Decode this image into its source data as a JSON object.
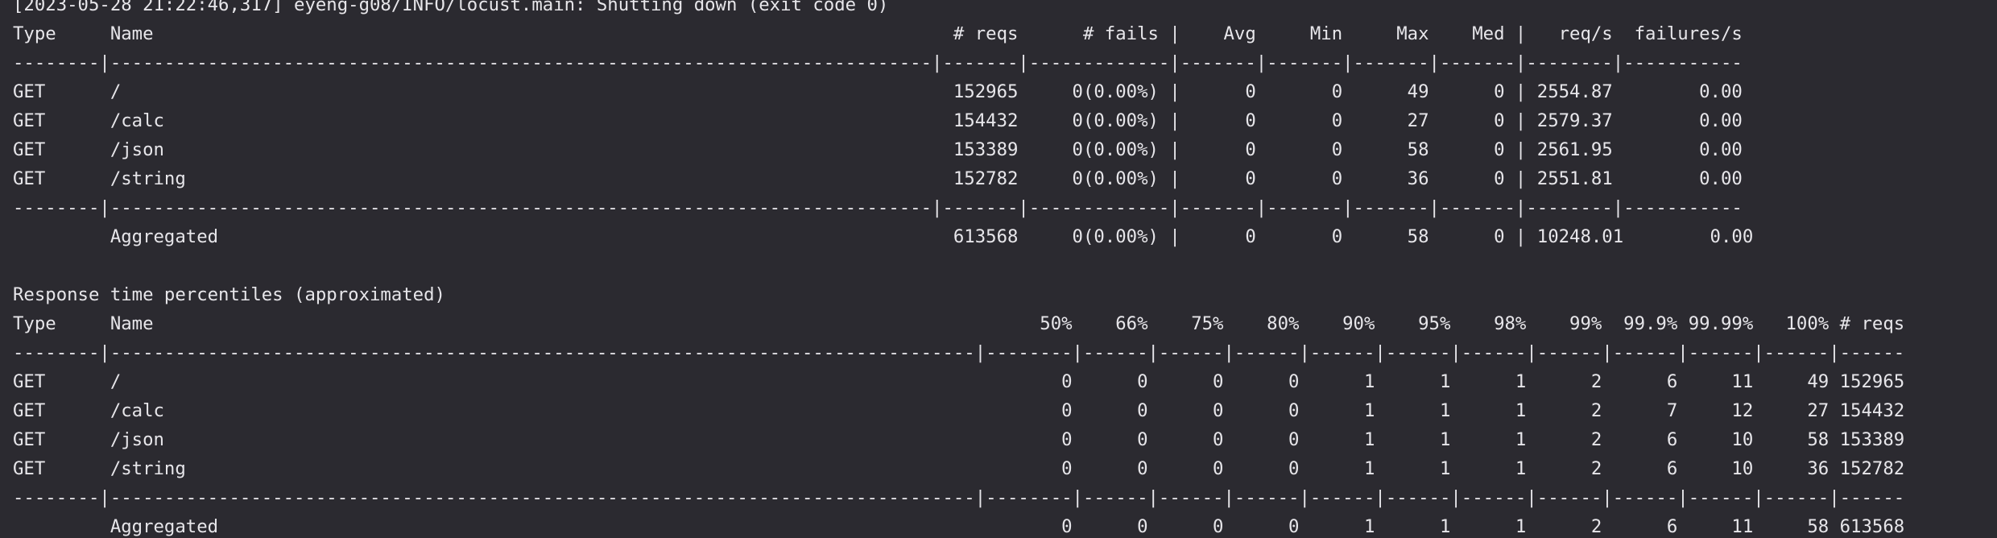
{
  "terminal": {
    "lines": [
      "[2023-05-28 21:22:46,317] eyeng-g08/INFO/locust.main: Shutting down (exit code 0)",
      "Type     Name                                                                          # reqs      # fails |    Avg     Min     Max    Med |   req/s  failures/s",
      "--------|----------------------------------------------------------------------------|-------|-------------|-------|-------|-------|-------|--------|-----------",
      "GET      /                                                                             152965     0(0.00%) |      0       0      49      0 | 2554.87        0.00",
      "GET      /calc                                                                         154432     0(0.00%) |      0       0      27      0 | 2579.37        0.00",
      "GET      /json                                                                         153389     0(0.00%) |      0       0      58      0 | 2561.95        0.00",
      "GET      /string                                                                       152782     0(0.00%) |      0       0      36      0 | 2551.81        0.00",
      "--------|----------------------------------------------------------------------------|-------|-------------|-------|-------|-------|-------|--------|-----------",
      "         Aggregated                                                                    613568     0(0.00%) |      0       0      58      0 | 10248.01        0.00",
      "",
      "Response time percentiles (approximated)",
      "Type     Name                                                                                  50%    66%    75%    80%    90%    95%    98%    99%  99.9% 99.99%   100% # reqs",
      "--------|--------------------------------------------------------------------------------|--------|------|------|------|------|------|------|------|------|------|------|------",
      "GET      /                                                                                       0      0      0      0      1      1      1      2      6     11     49 152965",
      "GET      /calc                                                                                   0      0      0      0      1      1      1      2      7     12     27 154432",
      "GET      /json                                                                                   0      0      0      0      1      1      1      2      6     10     58 153389",
      "GET      /string                                                                                 0      0      0      0      1      1      1      2      6     10     36 152782",
      "--------|--------------------------------------------------------------------------------|--------|------|------|------|------|------|------|------|------|------|------|------",
      "         Aggregated                                                                              0      0      0      0      1      1      1      2      6     11     58 613568"
    ]
  }
}
